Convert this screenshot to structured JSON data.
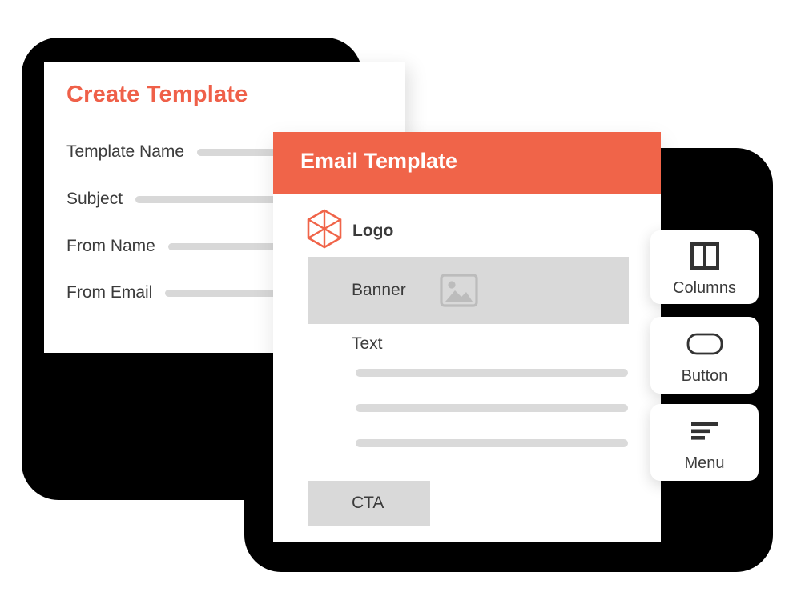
{
  "create_card": {
    "title": "Create Template",
    "fields": [
      {
        "label": "Template Name",
        "icon": "input-bar"
      },
      {
        "label": "Subject",
        "icon": "input-bar"
      },
      {
        "label": "From Name",
        "icon": "input-bar"
      },
      {
        "label": "From Email",
        "icon": "input-bar"
      }
    ]
  },
  "email_card": {
    "header_title": "Email Template",
    "header_color": "#F06449",
    "logo": {
      "label": "Logo",
      "icon": "hexagon-logo-icon",
      "color": "#F06449"
    },
    "banner": {
      "label": "Banner",
      "icon": "image-placeholder-icon"
    },
    "text": {
      "label": "Text",
      "lines": 3
    },
    "cta": {
      "label": "CTA"
    }
  },
  "widgets": [
    {
      "label": "Columns",
      "icon": "columns-icon"
    },
    {
      "label": "Button",
      "icon": "rounded-button-icon"
    },
    {
      "label": "Menu",
      "icon": "menu-lines-icon"
    }
  ],
  "colors": {
    "accent": "#F06449",
    "title_accent": "#EF6049",
    "text": "#3B3B3B",
    "placeholder_gray": "#D9D9D9",
    "bar_gray": "#DADADA",
    "shadow_black": "#000000",
    "card_white": "#FFFFFF"
  }
}
